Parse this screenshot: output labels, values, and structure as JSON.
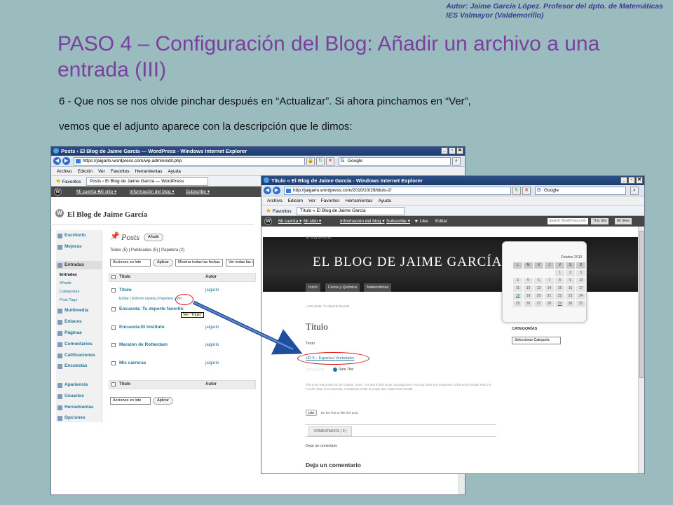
{
  "author": {
    "line1": "Autor: Jaime García López. Profesor del dpto. de Matemáticas",
    "line2": "IES Valmayor (Valdemorillo)"
  },
  "slide": {
    "title": "PASO 4 – Configuración del Blog: Añadir un archivo a una entrada (III)",
    "desc1": "6 - Que nos se nos olvide pinchar después en “Actualizar”.  Si ahora pinchamos en “Ver”,",
    "desc2": "vemos que el adjunto aparece con la descripción que le dimos:"
  },
  "win1": {
    "title": "Posts ‹ El Blog de Jaime García — WordPress - Windows Internet Explorer",
    "url": "https://jaigarlo.wordpress.com/wp-admin/edit.php",
    "search": "Google",
    "menu": [
      "Archivo",
      "Edición",
      "Ver",
      "Favoritos",
      "Herramientas",
      "Ayuda"
    ],
    "favorites": "Favoritos",
    "tab": "Posts ‹ El Blog de Jaime García — WordPress",
    "adminbar": [
      "Mi cuenta ▾",
      "Mi sitio ▾",
      "Información del blog ▾",
      "Subscribe ▾"
    ],
    "blogname": "El Blog de Jaime García",
    "menu_items": {
      "escritorio": "Escritorio",
      "mejoras": "Mejoras",
      "entradas": "Entradas",
      "multimedia": "Multimedia",
      "enlaces": "Enlaces",
      "paginas": "Páginas",
      "comentarios": "Comentarios",
      "calificaciones": "Calificaciones",
      "encuestas": "Encuestas",
      "apariencia": "Apariencia",
      "usuarios": "Usuarios",
      "herramientas": "Herramientas",
      "opciones": "Opciones"
    },
    "submenu": [
      "Entradas",
      "Añadir",
      "Categorías",
      "Post Tags"
    ],
    "posts_heading": "Posts",
    "add_button": "Añadir",
    "filters": "Todos (5) | Publicadas (5) | Papelera (2)",
    "bulk_action": "Acciones en lote",
    "apply": "Aplicar",
    "show_dates": "Mostrar todas las fechas",
    "show_cats": "Ver todas las categor",
    "col_title": "Título",
    "col_author": "Autor",
    "rows": [
      {
        "title": "Título",
        "author": "jaigarlo"
      },
      {
        "title": "Encuesta: Tu deporte favorito",
        "author": "jaigarlo"
      },
      {
        "title": "Encuesta:El Instituto",
        "author": "jaigarlo"
      },
      {
        "title": "Maratón de Rotterdam",
        "author": "jaigarlo"
      },
      {
        "title": "Mis carreras",
        "author": "jaigarlo"
      }
    ],
    "row_actions": "Editar | Edición rápida | Papelera | Ver",
    "tooltip": "Ver “Título”"
  },
  "win2": {
    "title": "Título « El Blog de Jaime García - Windows Internet Explorer",
    "url": "http://jaigarlo.wordpress.com/2010/10/29/titulo-2/",
    "search": "Google",
    "menu": [
      "Archivo",
      "Edición",
      "Ver",
      "Favoritos",
      "Herramientas",
      "Ayuda"
    ],
    "favorites": "Favoritos",
    "tab": "Título « El Blog de Jaime García",
    "adminbar": [
      "Mi cuenta ▾",
      "Mi sitio ▾",
      "Información del blog ▾",
      "Subscribe ▾",
      "★ Like",
      "Editar"
    ],
    "search_placeholder": "Search WordPress.com",
    "this_site": "This Site",
    "all_sites": "All Sites",
    "tagline": "Mi blog personal",
    "blog_title": "EL BLOG DE JAIME GARCÍA",
    "nav": [
      "Inicio",
      "Física y Química",
      "Matemáticas"
    ],
    "breadcrumb": "« Encuesta: Tu deporte favorito",
    "post_title": "Título",
    "post_text": "Texto",
    "attachment": "UD 5 – Espacios Vectoriales",
    "rate": "Rate This",
    "meta": "This entry was posted on 29 Octubre, 2010, 7:44 and is filed under Uncategorized. You can follow any responses to this entry through RSS 2.0. Puedes dejar una respuesta, o trackback desde tu propio sitio. Editar esta entrada",
    "like": "Like",
    "like_text": "Be the first to like this post.",
    "comments_tab": "COMENTARIOS ( 0 )",
    "leave_comment_small": "Dejar un comentario",
    "leave_comment": "Deja un comentario",
    "calendar": {
      "month": "Octubre 2010",
      "days": [
        "L",
        "M",
        "X",
        "J",
        "V",
        "S",
        "D"
      ],
      "weeks": [
        [
          "",
          "",
          "",
          "",
          "1",
          "2",
          "3"
        ],
        [
          "4",
          "5",
          "6",
          "7",
          "8",
          "9",
          "10"
        ],
        [
          "11",
          "12",
          "13",
          "14",
          "15",
          "16",
          "17"
        ],
        [
          "18",
          "19",
          "20",
          "21",
          "22",
          "23",
          "24"
        ],
        [
          "25",
          "26",
          "27",
          "28",
          "29",
          "30",
          "31"
        ]
      ]
    },
    "categories_label": "CATEGORÍAS",
    "category_select": "Seleccionar Categoría"
  }
}
